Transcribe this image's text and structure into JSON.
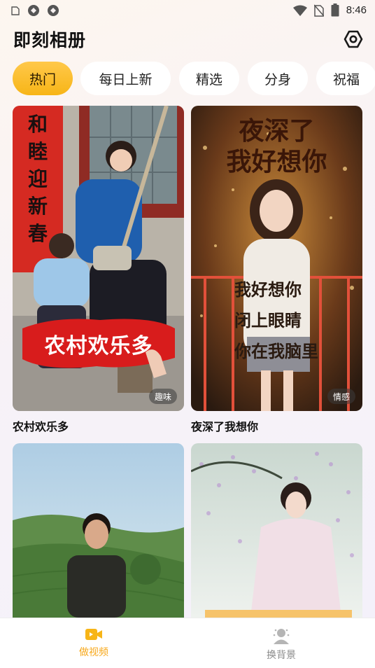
{
  "status_bar": {
    "time": "8:46",
    "left_icons": [
      "notification-app-icon",
      "sync-icon",
      "sync-icon"
    ],
    "right_icons": [
      "wifi-icon",
      "no-sim-icon",
      "battery-icon"
    ]
  },
  "header": {
    "title": "即刻相册",
    "settings_icon": "settings-hexagon-icon"
  },
  "tabs": [
    {
      "label": "热门",
      "active": true
    },
    {
      "label": "每日上新",
      "active": false
    },
    {
      "label": "精选",
      "active": false
    },
    {
      "label": "分身",
      "active": false
    },
    {
      "label": "祝福",
      "active": false
    }
  ],
  "cards": [
    {
      "title": "农村欢乐多",
      "tag": "趣味",
      "overlay_text": "农村欢乐多",
      "poster_text": [
        "和",
        "睦",
        "迎",
        "新",
        "春"
      ]
    },
    {
      "title": "夜深了我想你",
      "tag": "情感",
      "overlay_top": [
        "夜深了",
        "我好想你"
      ],
      "overlay_lines": [
        "我好想你",
        "闭上眼睛",
        "你在我脑里"
      ]
    },
    {
      "title": "",
      "tag": ""
    },
    {
      "title": "",
      "tag": ""
    }
  ],
  "bottom_nav": [
    {
      "label": "做视频",
      "icon": "video-camera-icon",
      "active": true
    },
    {
      "label": "换背景",
      "icon": "person-portrait-icon",
      "active": false
    }
  ],
  "colors": {
    "accent": "#f7b517",
    "nav_active": "#f7a81b",
    "nav_inactive": "#8a8a8a",
    "banner_red": "#d81c1c"
  }
}
